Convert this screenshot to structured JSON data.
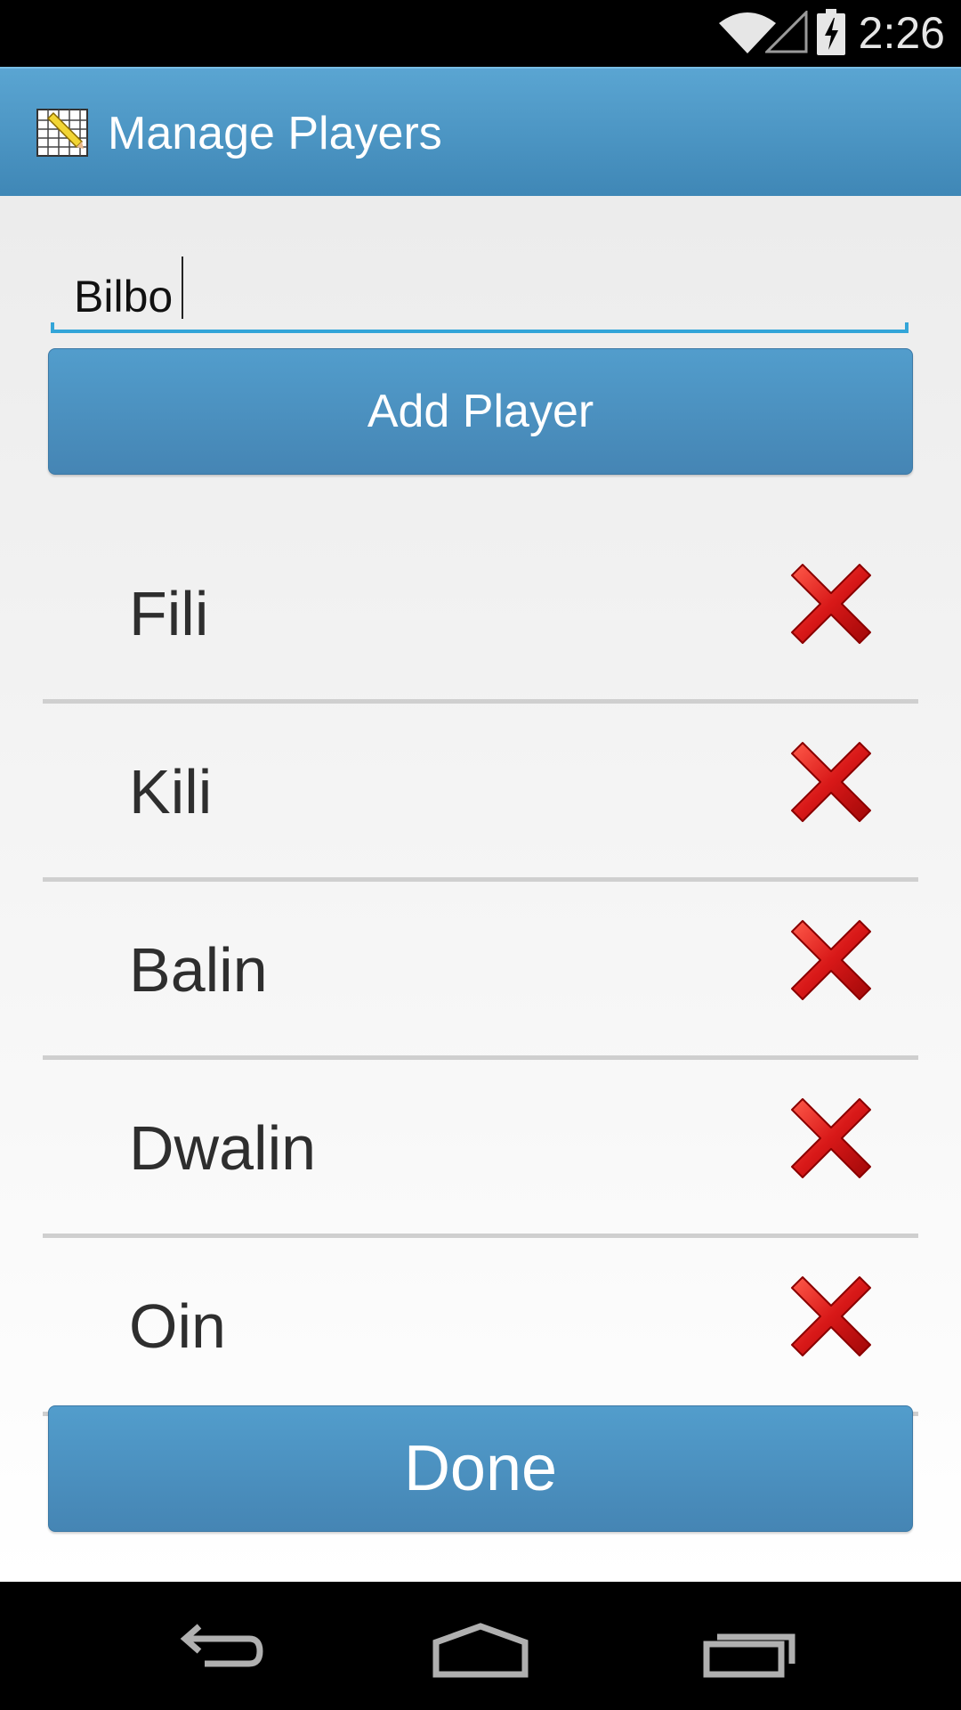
{
  "status_bar": {
    "time": "2:26",
    "icons": [
      "wifi-icon",
      "cell-signal-icon",
      "battery-charging-icon"
    ]
  },
  "action_bar": {
    "title": "Manage Players",
    "icon": "spreadsheet-pencil-icon"
  },
  "form": {
    "player_name_value": "Bilbo",
    "add_button_label": "Add Player"
  },
  "players": [
    {
      "name": "Fili"
    },
    {
      "name": "Kili"
    },
    {
      "name": "Balin"
    },
    {
      "name": "Dwalin"
    },
    {
      "name": "Oin"
    }
  ],
  "done_button_label": "Done",
  "nav_bar": {
    "icons": [
      "back-icon",
      "home-icon",
      "recent-apps-icon"
    ]
  },
  "colors": {
    "accent": "#4a90c2",
    "input_underline": "#33a5d8",
    "delete": "#cc1111"
  }
}
